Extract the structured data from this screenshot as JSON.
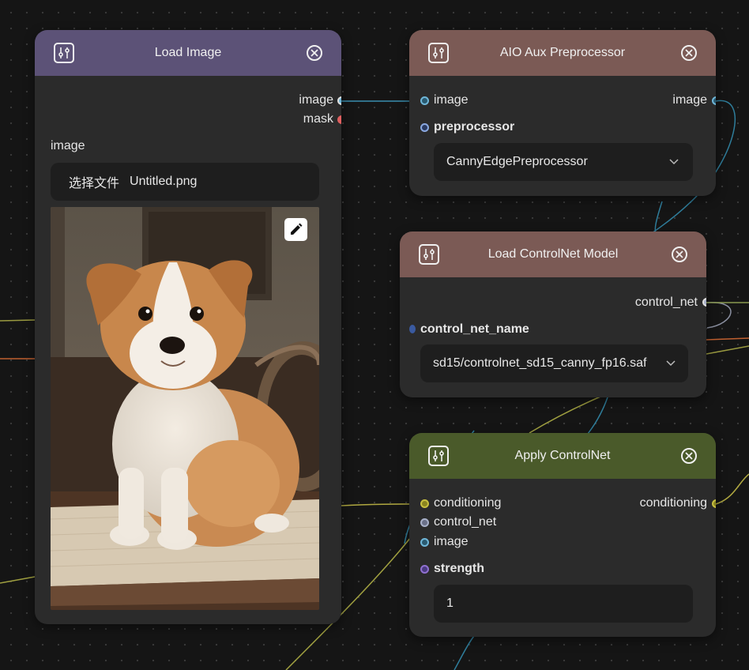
{
  "colors": {
    "load_image_header": "#5c5277",
    "aio_header": "#7b5a55",
    "controlnet_model_header": "#7b5a55",
    "apply_controlnet_header": "#4a5a2a",
    "image_socket": "#6fb6d8",
    "mask_socket": "#e06060",
    "preprocessor_socket": "#8aa8e0",
    "control_net_socket": "#a8b0c8",
    "conditioning_socket": "#c8c040",
    "strength_socket": "#9070d0"
  },
  "load_image": {
    "title": "Load Image",
    "outputs": {
      "image": "image",
      "mask": "mask"
    },
    "widget_label": "image",
    "choose_file": "选择文件",
    "filename": "Untitled.png"
  },
  "aio_aux": {
    "title": "AIO Aux Preprocessor",
    "input_image": "image",
    "output_image": "image",
    "preprocessor_label": "preprocessor",
    "preprocessor_value": "CannyEdgePreprocessor"
  },
  "controlnet_loader": {
    "title": "Load ControlNet Model",
    "output": "control_net",
    "name_label": "control_net_name",
    "name_value": "sd15/controlnet_sd15_canny_fp16.saf"
  },
  "apply_controlnet": {
    "title": "Apply ControlNet",
    "inputs": {
      "conditioning": "conditioning",
      "control_net": "control_net",
      "image": "image"
    },
    "output": "conditioning",
    "strength_label": "strength",
    "strength_value": "1"
  },
  "icons": {
    "node_menu": "sliders-icon",
    "node_close": "close-circle-icon",
    "edit": "pencil-icon",
    "dropdown": "chevron-down-icon"
  }
}
